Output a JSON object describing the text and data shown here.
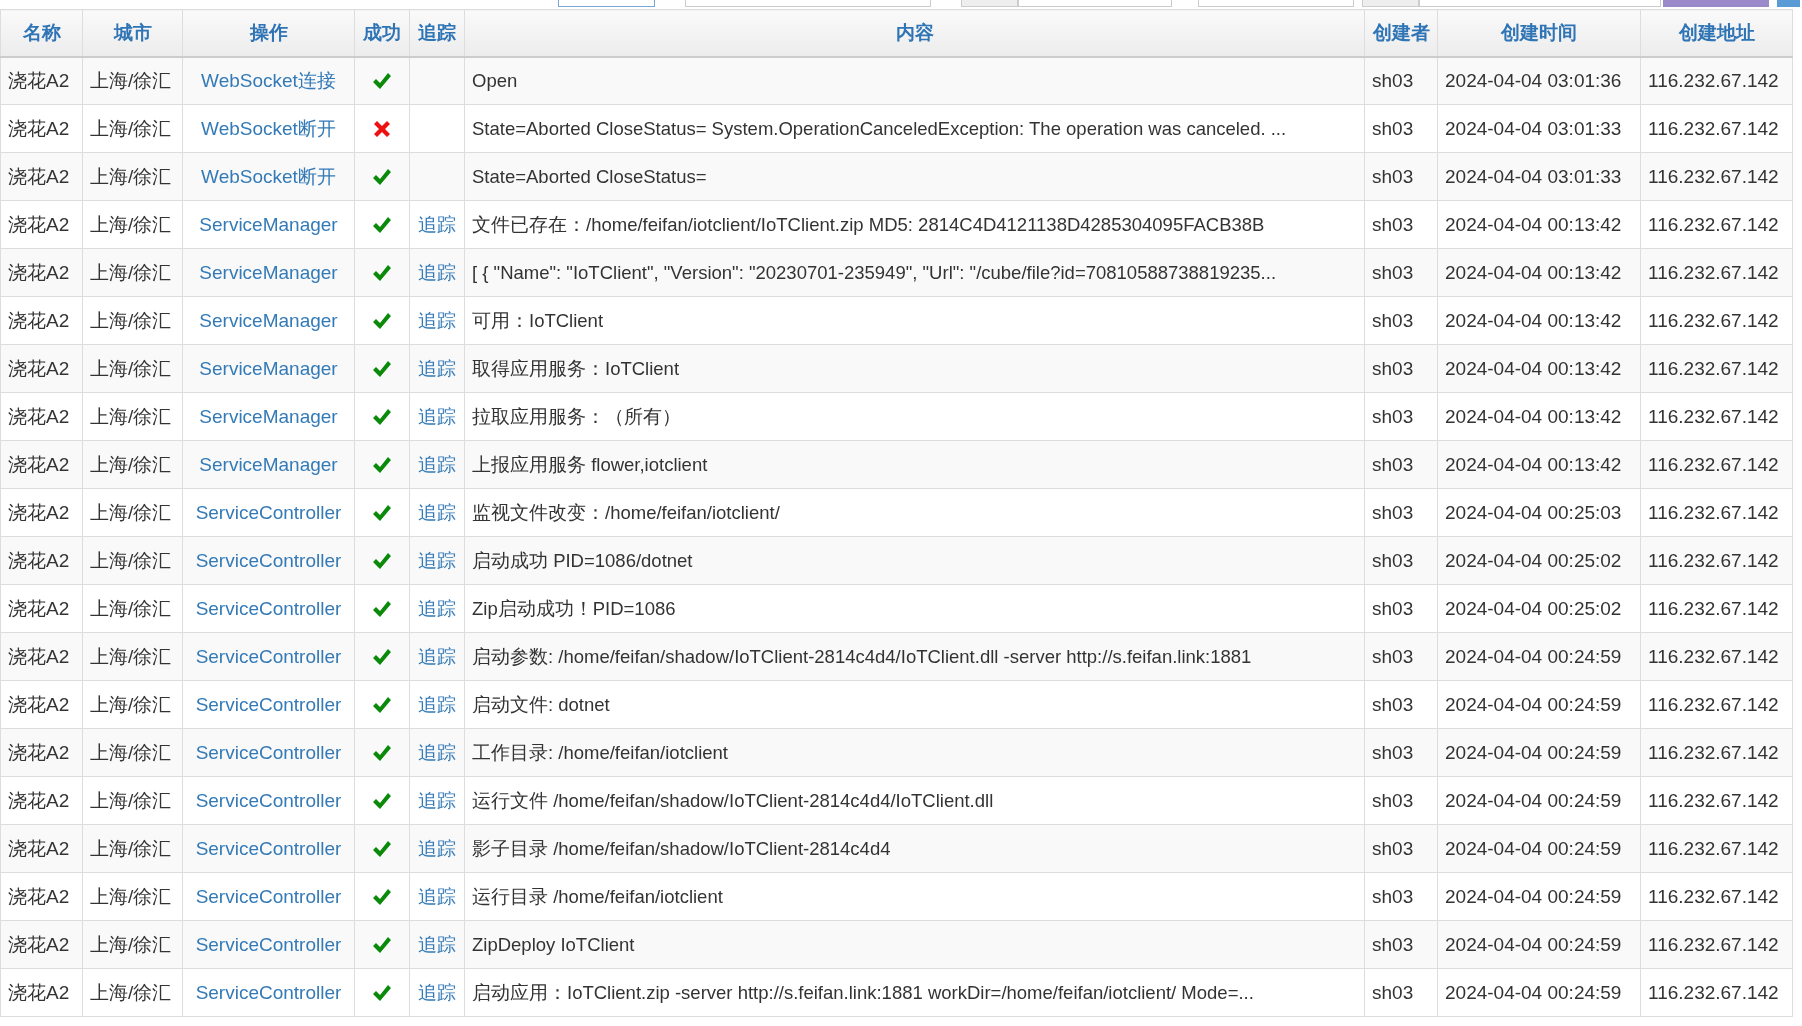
{
  "toolbar": {
    "controls": [
      {
        "kind": "field"
      },
      {
        "kind": "field"
      },
      {
        "kind": "addon"
      },
      {
        "kind": "field"
      },
      {
        "kind": "field"
      },
      {
        "kind": "addon"
      },
      {
        "kind": "field"
      },
      {
        "kind": "button"
      },
      {
        "kind": "button"
      }
    ]
  },
  "table": {
    "columns": [
      "名称",
      "城市",
      "操作",
      "成功",
      "追踪",
      "内容",
      "创建者",
      "创建时间",
      "创建地址"
    ],
    "rows": [
      {
        "name": "浇花A2",
        "city": "上海/徐汇",
        "action": "WebSocket连接",
        "success": true,
        "trace": "",
        "content": "Open",
        "creator": "sh03",
        "time": "2024-04-04 03:01:36",
        "address": "116.232.67.142"
      },
      {
        "name": "浇花A2",
        "city": "上海/徐汇",
        "action": "WebSocket断开",
        "success": false,
        "trace": "",
        "content": "State=Aborted CloseStatus= System.OperationCanceledException: The operation was canceled. ...",
        "creator": "sh03",
        "time": "2024-04-04 03:01:33",
        "address": "116.232.67.142"
      },
      {
        "name": "浇花A2",
        "city": "上海/徐汇",
        "action": "WebSocket断开",
        "success": true,
        "trace": "",
        "content": "State=Aborted CloseStatus=",
        "creator": "sh03",
        "time": "2024-04-04 03:01:33",
        "address": "116.232.67.142"
      },
      {
        "name": "浇花A2",
        "city": "上海/徐汇",
        "action": "ServiceManager",
        "success": true,
        "trace": "追踪",
        "content": "文件已存在：/home/feifan/iotclient/IoTClient.zip MD5: 2814C4D4121138D4285304095FACB38B",
        "creator": "sh03",
        "time": "2024-04-04 00:13:42",
        "address": "116.232.67.142"
      },
      {
        "name": "浇花A2",
        "city": "上海/徐汇",
        "action": "ServiceManager",
        "success": true,
        "trace": "追踪",
        "content": "[ { \"Name\": \"IoTClient\", \"Version\": \"20230701-235949\", \"Url\": \"/cube/file?id=70810588738819235...",
        "creator": "sh03",
        "time": "2024-04-04 00:13:42",
        "address": "116.232.67.142"
      },
      {
        "name": "浇花A2",
        "city": "上海/徐汇",
        "action": "ServiceManager",
        "success": true,
        "trace": "追踪",
        "content": "可用：IoTClient",
        "creator": "sh03",
        "time": "2024-04-04 00:13:42",
        "address": "116.232.67.142"
      },
      {
        "name": "浇花A2",
        "city": "上海/徐汇",
        "action": "ServiceManager",
        "success": true,
        "trace": "追踪",
        "content": "取得应用服务：IoTClient",
        "creator": "sh03",
        "time": "2024-04-04 00:13:42",
        "address": "116.232.67.142"
      },
      {
        "name": "浇花A2",
        "city": "上海/徐汇",
        "action": "ServiceManager",
        "success": true,
        "trace": "追踪",
        "content": "拉取应用服务：（所有）",
        "creator": "sh03",
        "time": "2024-04-04 00:13:42",
        "address": "116.232.67.142"
      },
      {
        "name": "浇花A2",
        "city": "上海/徐汇",
        "action": "ServiceManager",
        "success": true,
        "trace": "追踪",
        "content": "上报应用服务 flower,iotclient",
        "creator": "sh03",
        "time": "2024-04-04 00:13:42",
        "address": "116.232.67.142"
      },
      {
        "name": "浇花A2",
        "city": "上海/徐汇",
        "action": "ServiceController",
        "success": true,
        "trace": "追踪",
        "content": "监视文件改变：/home/feifan/iotclient/",
        "creator": "sh03",
        "time": "2024-04-04 00:25:03",
        "address": "116.232.67.142"
      },
      {
        "name": "浇花A2",
        "city": "上海/徐汇",
        "action": "ServiceController",
        "success": true,
        "trace": "追踪",
        "content": "启动成功 PID=1086/dotnet",
        "creator": "sh03",
        "time": "2024-04-04 00:25:02",
        "address": "116.232.67.142"
      },
      {
        "name": "浇花A2",
        "city": "上海/徐汇",
        "action": "ServiceController",
        "success": true,
        "trace": "追踪",
        "content": "Zip启动成功！PID=1086",
        "creator": "sh03",
        "time": "2024-04-04 00:25:02",
        "address": "116.232.67.142"
      },
      {
        "name": "浇花A2",
        "city": "上海/徐汇",
        "action": "ServiceController",
        "success": true,
        "trace": "追踪",
        "content": "启动参数: /home/feifan/shadow/IoTClient-2814c4d4/IoTClient.dll -server http://s.feifan.link:1881",
        "creator": "sh03",
        "time": "2024-04-04 00:24:59",
        "address": "116.232.67.142"
      },
      {
        "name": "浇花A2",
        "city": "上海/徐汇",
        "action": "ServiceController",
        "success": true,
        "trace": "追踪",
        "content": "启动文件: dotnet",
        "creator": "sh03",
        "time": "2024-04-04 00:24:59",
        "address": "116.232.67.142"
      },
      {
        "name": "浇花A2",
        "city": "上海/徐汇",
        "action": "ServiceController",
        "success": true,
        "trace": "追踪",
        "content": "工作目录: /home/feifan/iotclient",
        "creator": "sh03",
        "time": "2024-04-04 00:24:59",
        "address": "116.232.67.142"
      },
      {
        "name": "浇花A2",
        "city": "上海/徐汇",
        "action": "ServiceController",
        "success": true,
        "trace": "追踪",
        "content": "运行文件 /home/feifan/shadow/IoTClient-2814c4d4/IoTClient.dll",
        "creator": "sh03",
        "time": "2024-04-04 00:24:59",
        "address": "116.232.67.142"
      },
      {
        "name": "浇花A2",
        "city": "上海/徐汇",
        "action": "ServiceController",
        "success": true,
        "trace": "追踪",
        "content": "影子目录 /home/feifan/shadow/IoTClient-2814c4d4",
        "creator": "sh03",
        "time": "2024-04-04 00:24:59",
        "address": "116.232.67.142"
      },
      {
        "name": "浇花A2",
        "city": "上海/徐汇",
        "action": "ServiceController",
        "success": true,
        "trace": "追踪",
        "content": "运行目录 /home/feifan/iotclient",
        "creator": "sh03",
        "time": "2024-04-04 00:24:59",
        "address": "116.232.67.142"
      },
      {
        "name": "浇花A2",
        "city": "上海/徐汇",
        "action": "ServiceController",
        "success": true,
        "trace": "追踪",
        "content": "ZipDeploy IoTClient",
        "creator": "sh03",
        "time": "2024-04-04 00:24:59",
        "address": "116.232.67.142"
      },
      {
        "name": "浇花A2",
        "city": "上海/徐汇",
        "action": "ServiceController",
        "success": true,
        "trace": "追踪",
        "content": "启动应用：IoTClient.zip -server http://s.feifan.link:1881 workDir=/home/feifan/iotclient/ Mode=...",
        "creator": "sh03",
        "time": "2024-04-04 00:24:59",
        "address": "116.232.67.142"
      }
    ]
  }
}
